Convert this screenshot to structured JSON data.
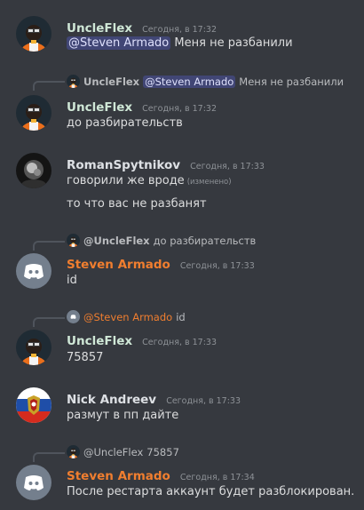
{
  "messages": [
    {
      "author": "UncleFlex",
      "timestamp": "Сегодня, в 17:32",
      "mention": "@Steven Armado",
      "text": "Меня не разбанили"
    },
    {
      "reply": {
        "author": "UncleFlex",
        "mention": "@Steven Armado",
        "text": "Меня не разбанили"
      },
      "author": "UncleFlex",
      "timestamp": "Сегодня, в 17:32",
      "text": "до разбирательств"
    },
    {
      "author": "RomanSpytnikov",
      "timestamp": "Сегодня, в 17:33",
      "text": "говорили же вроде",
      "edited": "(изменено)",
      "text2": "то что вас не разбанят"
    },
    {
      "reply": {
        "author": "@UncleFlex",
        "text": "до разбирательств"
      },
      "author": "Steven Armado",
      "timestamp": "Сегодня, в 17:33",
      "text": "id"
    },
    {
      "reply": {
        "author": "@Steven Armado",
        "text": "id"
      },
      "author": "UncleFlex",
      "timestamp": "Сегодня, в 17:33",
      "text": "75857"
    },
    {
      "author": "Nick Andreev",
      "timestamp": "Сегодня, в 17:33",
      "text": "размут в пп дайте"
    },
    {
      "reply": {
        "author": "@UncleFlex",
        "text": "75857"
      },
      "author": "Steven Armado",
      "timestamp": "Сегодня, в 17:34",
      "text": "После рестарта аккаунт будет разблокирован."
    }
  ],
  "colors": {
    "background": "#36393f",
    "author_default": "#cfe7d6",
    "author_orange": "#f07e2f",
    "mention_bg": "#414675",
    "text": "#dcddde",
    "muted": "#8e9297"
  }
}
